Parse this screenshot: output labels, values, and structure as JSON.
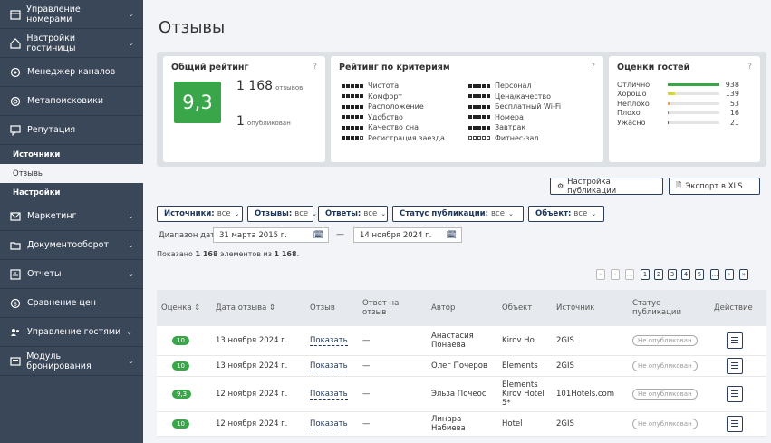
{
  "sidebar": {
    "items": [
      {
        "label": "Управление номерами",
        "icon": "calendar-icon",
        "chev": "⌄"
      },
      {
        "label": "Настройки гостиницы",
        "icon": "home-icon",
        "chev": "⌄"
      },
      {
        "label": "Менеджер каналов",
        "icon": "network-icon",
        "chev": ""
      },
      {
        "label": "Метапоисковики",
        "icon": "search-icon",
        "chev": ""
      },
      {
        "label": "Репутация",
        "icon": "chat-icon",
        "chev": ""
      }
    ],
    "sub": [
      {
        "label": "Источники"
      },
      {
        "label": "Отзывы"
      },
      {
        "label": "Настройки"
      }
    ],
    "items2": [
      {
        "label": "Маркетинг",
        "icon": "mail-icon",
        "chev": "⌄"
      },
      {
        "label": "Документооборот",
        "icon": "folder-icon",
        "chev": "⌄"
      },
      {
        "label": "Отчеты",
        "icon": "chart-icon",
        "chev": "⌄"
      },
      {
        "label": "Сравнение цен",
        "icon": "coin-icon",
        "chev": ""
      },
      {
        "label": "Управление гостями",
        "icon": "users-icon",
        "chev": "⌄"
      },
      {
        "label": "Модуль бронирования",
        "icon": "booking-icon",
        "chev": "⌄"
      }
    ]
  },
  "page": {
    "title": "Отзывы"
  },
  "overall": {
    "title": "Общий рейтинг",
    "help": "?",
    "score": "9,3",
    "reviews_count": "1 168",
    "reviews_word": "отзывов",
    "published_count": "1",
    "published_word": "опубликован"
  },
  "criteria": {
    "title": "Рейтинг по критериям",
    "help": "?",
    "col1": [
      {
        "label": "Чистота",
        "stars": 5
      },
      {
        "label": "Комфорт",
        "stars": 5
      },
      {
        "label": "Расположение",
        "stars": 5
      },
      {
        "label": "Удобство",
        "stars": 5
      },
      {
        "label": "Качество сна",
        "stars": 5
      },
      {
        "label": "Регистрация заезда",
        "stars": 4
      }
    ],
    "col2": [
      {
        "label": "Персонал",
        "stars": 5
      },
      {
        "label": "Цена/качество",
        "stars": 5
      },
      {
        "label": "Бесплатный Wi-Fi",
        "stars": 5
      },
      {
        "label": "Номера",
        "stars": 5
      },
      {
        "label": "Завтрак",
        "stars": 5
      },
      {
        "label": "Фитнес-зал",
        "stars": 0
      }
    ]
  },
  "guests": {
    "title": "Оценки гостей",
    "help": "?",
    "rows": [
      {
        "label": "Отлично",
        "count": "938",
        "value": 938,
        "color": "#3aa64a"
      },
      {
        "label": "Хорошо",
        "count": "139",
        "value": 139,
        "color": "#d8d43a"
      },
      {
        "label": "Неплохо",
        "count": "53",
        "value": 53,
        "color": "#f2a13a"
      },
      {
        "label": "Плохо",
        "count": "16",
        "value": 16,
        "color": "#e66b2c"
      },
      {
        "label": "Ужасно",
        "count": "21",
        "value": 21,
        "color": "#d9342b"
      }
    ],
    "max": 938
  },
  "toolbar": {
    "publish_settings": "Настройка публикации",
    "export": "Экспорт в XLS"
  },
  "filters": [
    {
      "key": "Источники:",
      "value": "все"
    },
    {
      "key": "Отзывы:",
      "value": "все"
    },
    {
      "key": "Ответы:",
      "value": "все"
    },
    {
      "key": "Статус публикации:",
      "value": "все"
    },
    {
      "key": "Объект:",
      "value": "все"
    }
  ],
  "dates": {
    "label": "Диапазон дат:",
    "from": "31 марта 2015 г.",
    "dash": "—",
    "to": "14 ноября 2024 г."
  },
  "shown": {
    "prefix": "Показано ",
    "count": "1 168",
    "middle": " элементов из ",
    "total": "1 168",
    "suffix": "."
  },
  "pagination": {
    "pages": [
      "«",
      "‹",
      "...",
      "1",
      "2",
      "3",
      "4",
      "5",
      "...",
      "›",
      "»"
    ]
  },
  "table": {
    "headers": [
      "Оценка ⇕",
      "Дата отзыва ⇕",
      "Отзыв",
      "Ответ на отзыв",
      "Автор",
      "Объект",
      "Источник",
      "Статус публикации",
      "Действие"
    ],
    "rows": [
      {
        "score": "10",
        "date": "13 ноября 2024 г.",
        "review": "Показать",
        "answer": "—",
        "author": "Анастасия Понаева",
        "object": "Kirov Ho",
        "source": "2GIS",
        "status": "Не опубликован"
      },
      {
        "score": "10",
        "date": "13 ноября 2024 г.",
        "review": "Показать",
        "answer": "—",
        "author": "Олег Почеров",
        "object": "Elements",
        "source": "2GIS",
        "status": "Не опубликован"
      },
      {
        "score": "9,3",
        "date": "12 ноября 2024 г.",
        "review": "Показать",
        "answer": "—",
        "author": "Эльза Почеос",
        "object": "Elements Kirov Hotel 5*",
        "source": "101Hotels.com",
        "status": "Не опубликован"
      },
      {
        "score": "10",
        "date": "12 ноября 2024 г.",
        "review": "Показать",
        "answer": "—",
        "author": "Линара Набиева",
        "object": "Hotel",
        "source": "2GIS",
        "status": "Не опубликован"
      }
    ]
  }
}
